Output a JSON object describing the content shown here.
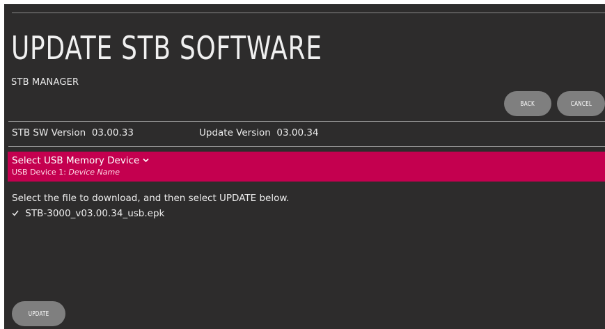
{
  "header": {
    "title": "UPDATE STB SOFTWARE",
    "subtitle": "STB MANAGER"
  },
  "actions": {
    "back_label": "BACK",
    "cancel_label": "CANCEL",
    "update_label": "UPDATE"
  },
  "versions": {
    "current_label": "STB SW Version",
    "current_value": "03.00.33",
    "update_label": "Update Version",
    "update_value": "03.00.34"
  },
  "usb": {
    "select_label": "Select USB Memory Device",
    "chevron_icon": "chevron-down-icon",
    "device_prefix": "USB Device 1:",
    "device_name": "Device Name"
  },
  "instruction": "Select the file to download, and then select UPDATE below.",
  "files": [
    {
      "checked": true,
      "check_icon": "check-icon",
      "name": "STB-3000_v03.00.34_usb.epk"
    }
  ],
  "colors": {
    "background": "#2d2c2c",
    "accent": "#c4004f",
    "button": "#7f7f7f",
    "text": "#e6e6e6"
  }
}
